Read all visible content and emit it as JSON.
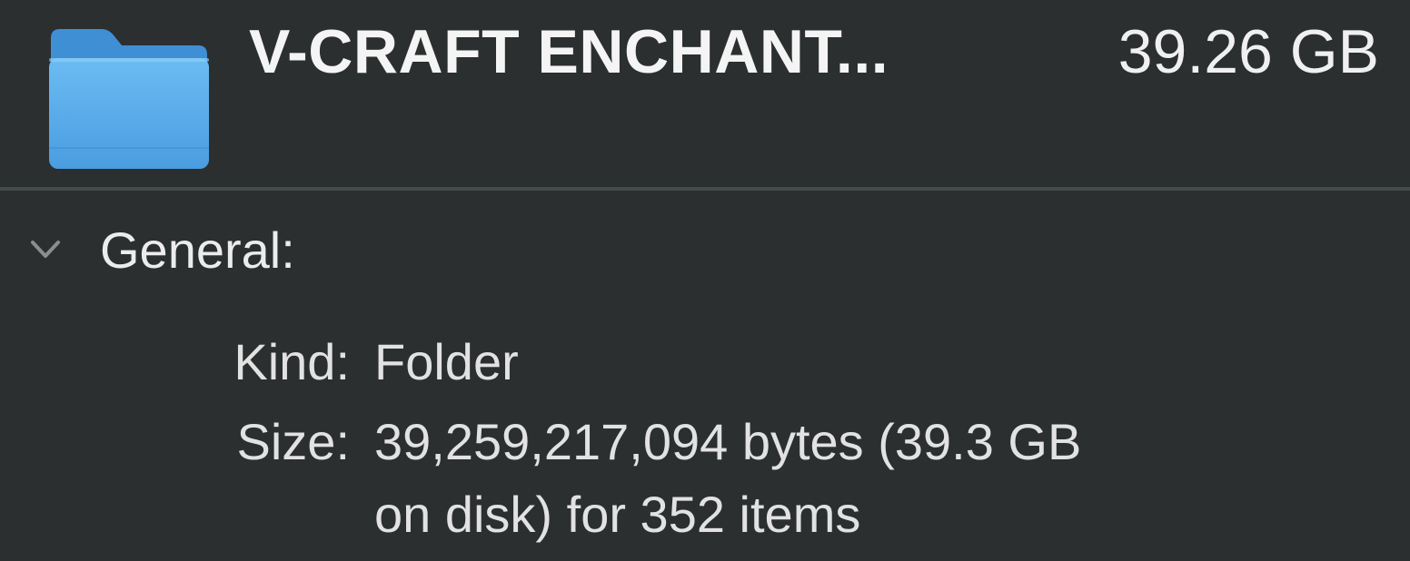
{
  "header": {
    "icon": "folder-icon",
    "title": "V-CRAFT ENCHANT...",
    "size": "39.26 GB"
  },
  "general": {
    "label": "General:",
    "expanded": true,
    "kind_label": "Kind:",
    "kind_value": "Folder",
    "size_label": "Size:",
    "size_value_line1": "39,259,217,094 bytes (39.3 GB",
    "size_value_line2": "on disk) for 352 items"
  },
  "colors": {
    "background": "#2b2f30",
    "folder_blue": "#5aaeea",
    "text": "#e6e6e6"
  }
}
